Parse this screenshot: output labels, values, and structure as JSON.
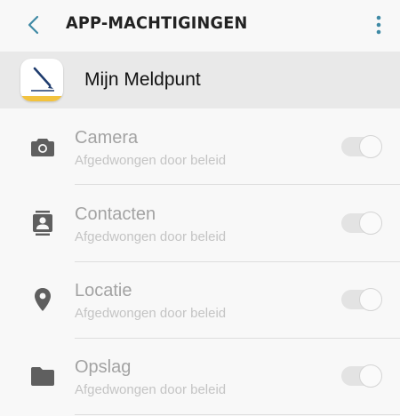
{
  "header": {
    "title": "APP-MACHTIGINGEN",
    "back_icon": "chevron-left-icon",
    "more_icon": "more-vert-icon",
    "accent_color": "#3f8aa5"
  },
  "app": {
    "name": "Mijn Meldpunt",
    "icon": "pen-app-icon",
    "icon_accent_color": "#f2c23e"
  },
  "permissions": [
    {
      "label": "Camera",
      "subtitle": "Afgedwongen door beleid",
      "icon": "camera-icon",
      "enabled": true,
      "disabled": true
    },
    {
      "label": "Contacten",
      "subtitle": "Afgedwongen door beleid",
      "icon": "contacts-icon",
      "enabled": true,
      "disabled": true
    },
    {
      "label": "Locatie",
      "subtitle": "Afgedwongen door beleid",
      "icon": "location-icon",
      "enabled": true,
      "disabled": true
    },
    {
      "label": "Opslag",
      "subtitle": "Afgedwongen door beleid",
      "icon": "folder-icon",
      "enabled": true,
      "disabled": true
    }
  ]
}
